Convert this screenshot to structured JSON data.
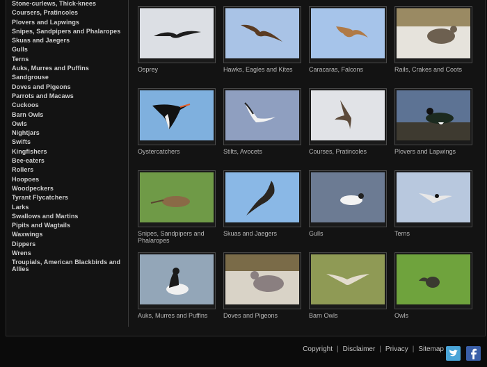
{
  "sidebar": {
    "items": [
      "Stone-curlews, Thick-knees",
      "Coursers, Pratincoles",
      "Plovers and Lapwings",
      "Snipes, Sandpipers and Phalaropes",
      "Skuas and Jaegers",
      "Gulls",
      "Terns",
      "Auks, Murres and Puffins",
      "Sandgrouse",
      "Doves and Pigeons",
      "Parrots and Macaws",
      "Cuckoos",
      "Barn Owls",
      "Owls",
      "Nightjars",
      "Swifts",
      "Kingfishers",
      "Bee-eaters",
      "Rollers",
      "Hoopoes",
      "Woodpeckers",
      "Tyrant Flycatchers",
      "Larks",
      "Swallows and Martins",
      "Pipits and Wagtails",
      "Waxwings",
      "Dippers",
      "Wrens",
      "Troupials, American Blackbirds and Allies"
    ]
  },
  "gallery": [
    {
      "caption": "Osprey",
      "icon": "osprey-photo",
      "bg": "#dcdfe4"
    },
    {
      "caption": "Hawks, Eagles and Kites",
      "icon": "kite-photo",
      "bg": "#a9c3e6"
    },
    {
      "caption": "Caracaras, Falcons",
      "icon": "falcon-photo",
      "bg": "#a6c4ea"
    },
    {
      "caption": "Rails, Crakes and Coots",
      "icon": "rail-photo",
      "bg": "#e6e3dc"
    },
    {
      "caption": "Oystercatchers",
      "icon": "oystercatcher-photo",
      "bg": "#7fb0de"
    },
    {
      "caption": "Stilts, Avocets",
      "icon": "avocet-photo",
      "bg": "#8f9fc0"
    },
    {
      "caption": "Courses, Pratincoles",
      "icon": "pratincole-photo",
      "bg": "#e1e3e7"
    },
    {
      "caption": "Plovers and Lapwings",
      "icon": "lapwing-photo",
      "bg": "#5d7394"
    },
    {
      "caption": "Snipes, Sandpipers and Phalaropes",
      "icon": "snipe-photo",
      "bg": "#6f9a47"
    },
    {
      "caption": "Skuas and Jaegers",
      "icon": "skua-photo",
      "bg": "#8ab8e6"
    },
    {
      "caption": "Gulls",
      "icon": "gull-photo",
      "bg": "#6c7b93"
    },
    {
      "caption": "Terns",
      "icon": "tern-photo",
      "bg": "#b8c8de"
    },
    {
      "caption": "Auks, Murres and Puffins",
      "icon": "murre-photo",
      "bg": "#93a6b8"
    },
    {
      "caption": "Doves and Pigeons",
      "icon": "dove-photo",
      "bg": "#d9d3c7"
    },
    {
      "caption": "Barn Owls",
      "icon": "barn-owl-photo",
      "bg": "#8f9a55"
    },
    {
      "caption": "Owls",
      "icon": "owl-photo",
      "bg": "#6fa33d"
    }
  ],
  "footer": {
    "links": [
      "Copyright",
      "Disclaimer",
      "Privacy",
      "Sitemap"
    ],
    "twitter_icon": "twitter-icon",
    "facebook_icon": "facebook-icon",
    "twitter_color": "#4aa5d8",
    "facebook_color": "#3a5fa8"
  }
}
